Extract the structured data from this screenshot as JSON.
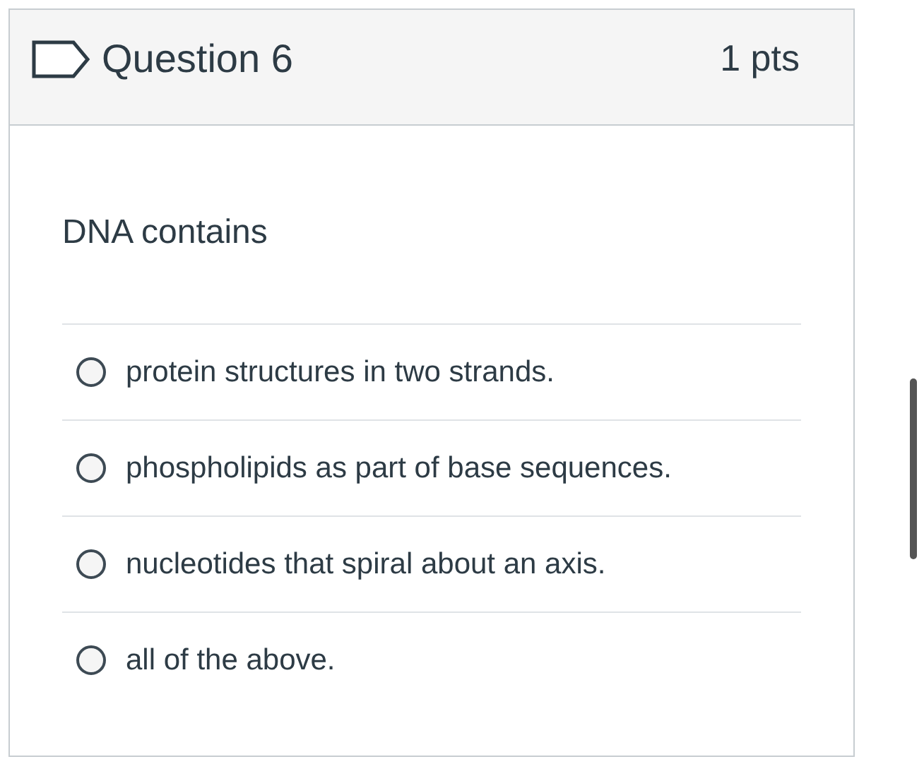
{
  "question": {
    "title": "Question 6",
    "points": "1 pts",
    "prompt": "DNA contains",
    "answers": [
      {
        "label": "protein structures in two strands.",
        "selected": false
      },
      {
        "label": "phospholipids as part of base sequences.",
        "selected": false
      },
      {
        "label": "nucleotides that spiral about an axis.",
        "selected": false
      },
      {
        "label": "all of the above.",
        "selected": false
      }
    ]
  }
}
